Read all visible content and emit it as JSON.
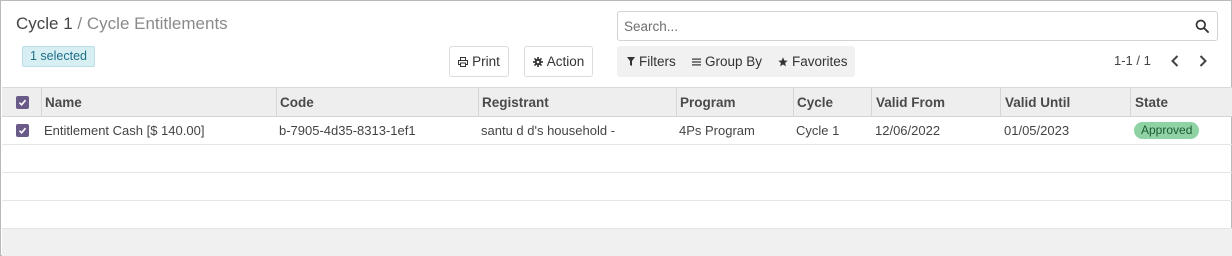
{
  "breadcrumb": {
    "parent": "Cycle 1",
    "separator": "/",
    "current": "Cycle Entitlements"
  },
  "selection": {
    "badge": "1 selected"
  },
  "toolbar": {
    "print_label": "Print",
    "action_label": "Action"
  },
  "search": {
    "placeholder": "Search..."
  },
  "filters": {
    "filters_label": "Filters",
    "groupby_label": "Group By",
    "favorites_label": "Favorites"
  },
  "pager": {
    "value": "1-1 / 1"
  },
  "table": {
    "columns": [
      "Name",
      "Code",
      "Registrant",
      "Program",
      "Cycle",
      "Valid From",
      "Valid Until",
      "State"
    ],
    "rows": [
      {
        "selected": true,
        "name": "Entitlement Cash [$ 140.00]",
        "code": "b-7905-4d35-8313-1ef1",
        "registrant": "santu d d's household -",
        "program": "4Ps Program",
        "cycle": "Cycle 1",
        "valid_from": "12/06/2022",
        "valid_until": "01/05/2023",
        "state": "Approved"
      }
    ]
  },
  "colors": {
    "checkbox": "#6a5a88",
    "state_approved_bg": "#8fd3a4",
    "selected_badge_bg": "#d7eef3"
  },
  "icons": {
    "print": "printer-icon",
    "action": "gear-icon",
    "search": "magnifier-icon",
    "filters": "funnel-icon",
    "groupby": "bars-icon",
    "favorites": "star-icon",
    "pager_prev": "chevron-left-icon",
    "pager_next": "chevron-right-icon"
  }
}
